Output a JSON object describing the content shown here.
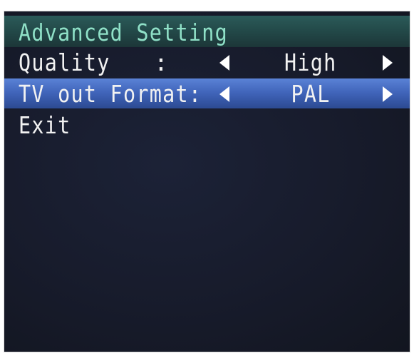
{
  "menu": {
    "title": "Advanced Setting",
    "items": [
      {
        "label": "Quality",
        "separator": ":",
        "value": "High",
        "selected": false
      },
      {
        "label": "TV out Format:",
        "value": "PAL",
        "selected": true
      },
      {
        "label": "Exit",
        "selected": false
      }
    ]
  },
  "icons": {
    "left_arrow": "triangle-left-icon",
    "right_arrow": "triangle-right-icon"
  },
  "colors": {
    "title_text": "#8fe0c7",
    "title_bar": "#244c4b",
    "selection_bar": "#3f63b8",
    "background": "#171b2b",
    "item_text": "#f2f2f2"
  }
}
